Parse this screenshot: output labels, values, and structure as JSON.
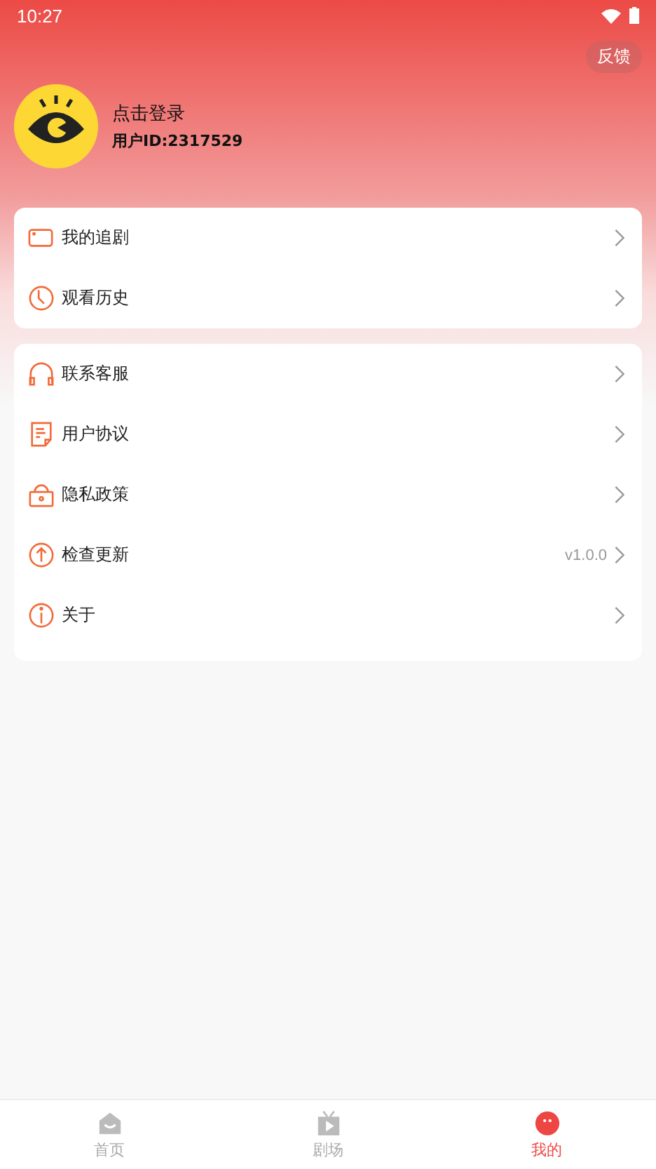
{
  "status_bar": {
    "time": "10:27"
  },
  "feedback_button": "反馈",
  "profile": {
    "name": "点击登录",
    "user_id": "用户ID:2317529"
  },
  "menu_groups": [
    {
      "items": [
        {
          "kind": "tv",
          "label": "我的追剧"
        },
        {
          "kind": "clock",
          "label": "观看历史"
        }
      ]
    },
    {
      "items": [
        {
          "kind": "headset",
          "label": "联系客服"
        },
        {
          "kind": "doc",
          "label": "用户协议"
        },
        {
          "kind": "lock",
          "label": "隐私政策"
        },
        {
          "kind": "upload",
          "label": "检查更新",
          "value": "v1.0.0"
        },
        {
          "kind": "info",
          "label": "关于"
        }
      ]
    }
  ],
  "tabs": [
    {
      "kind": "home",
      "label": "首页",
      "selected": false
    },
    {
      "kind": "theater",
      "label": "剧场",
      "selected": false
    },
    {
      "kind": "face",
      "label": "我的",
      "selected": true
    }
  ]
}
